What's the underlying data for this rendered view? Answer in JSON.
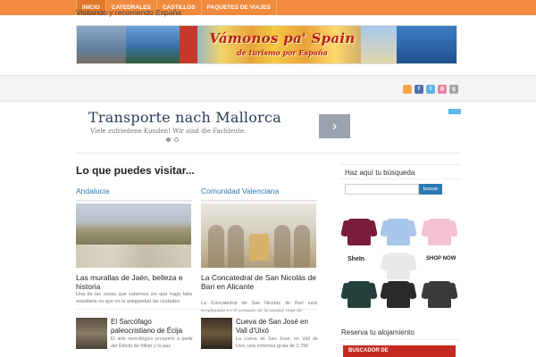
{
  "nav": {
    "items": [
      "INICIO",
      "CATEDRALES",
      "CASTILLOS",
      "PAQUETES DE VIAJES"
    ]
  },
  "banner": {
    "title": "Vámonos pa' Spain",
    "subtitle": "de turismo por España"
  },
  "tagline": "Visitando y recorriendo España",
  "ad": {
    "title": "Transporte nach Mallorca",
    "subtitle": "Viele zufriedene Kunden! Wir sind die Fachleute.",
    "next_glyph": "›"
  },
  "main": {
    "section_title": "Lo que puedes visitar...",
    "columns": [
      {
        "heading": "Andalucia",
        "post_title": "Las murallas de Jaén, belleza e historia",
        "excerpt": "Una de las cosas que sabemos sin que haga falta estudiarlo es que en la antigüedad las ciudades",
        "small_title": "El Sarcófago paleocristiano de Écija",
        "small_excerpt": "El arte necrológico prosperó a partir del Edicto de Milán y la paz"
      },
      {
        "heading": "Comunidad Valenciana",
        "post_title": "La Concatedral de San Nicolás de Bari en Alicante",
        "excerpt": "La Concatedral de San Nicolás de Bari está emplazada en el corazón de la ciudad vieja de",
        "small_title": "Cueva de San José en Vall d'Uixó",
        "small_excerpt": "La cueva de San José, en Vall de Uxo, una inmensa gruta de 2.750"
      }
    ]
  },
  "sidebar": {
    "search_heading": "Haz aquí tu búsqueda",
    "search_button": "buscar",
    "search_value": "",
    "shop_labels": [
      "SheIn",
      "SHOP NOW"
    ],
    "reserve_heading": "Reserva tu alojamiento",
    "buscador": "BUSCADOR DE"
  },
  "social_icons": [
    "rss-icon",
    "facebook-icon",
    "twitter-icon",
    "dribbble-icon",
    "google-plus-icon"
  ],
  "colors": {
    "nav": "#f08a3c",
    "link": "#2c78b3",
    "button": "#2c78b3"
  }
}
